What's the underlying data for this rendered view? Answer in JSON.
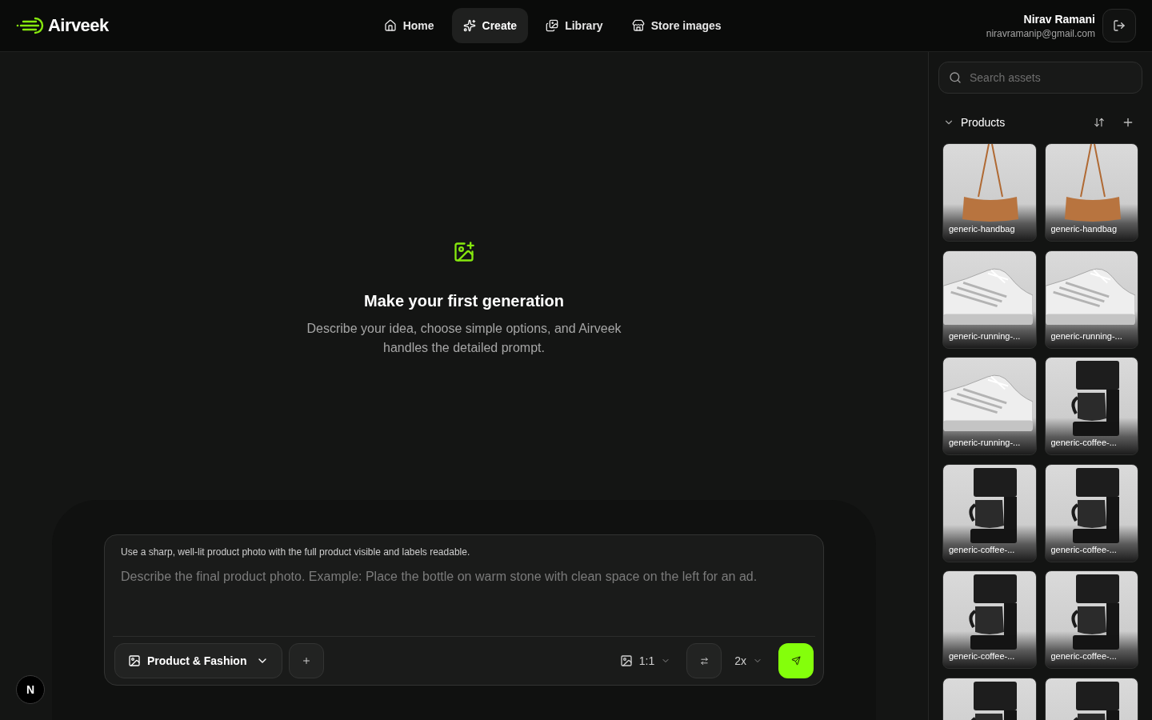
{
  "header": {
    "brand": "Airveek",
    "nav": [
      {
        "label": "Home",
        "selected": false
      },
      {
        "label": "Create",
        "selected": true
      },
      {
        "label": "Library",
        "selected": false
      },
      {
        "label": "Store images",
        "selected": false
      }
    ],
    "user": {
      "name": "Nirav Ramani",
      "email": "niravramanip@gmail.com"
    }
  },
  "empty_state": {
    "title": "Make your first generation",
    "description": "Describe your idea, choose simple options, and Airveek handles the detailed prompt."
  },
  "composer": {
    "hint": "Use a sharp, well-lit product photo with the full product visible and labels readable.",
    "placeholder": "Describe the final product photo. Example: Place the bottle on warm stone with clean space on the left for an ad.",
    "category": "Product & Fashion",
    "aspect_ratio": "1:1",
    "count": "2x"
  },
  "dev_badge": {
    "label": "N"
  },
  "sidebar": {
    "search": {
      "placeholder": "Search assets"
    },
    "section": {
      "title": "Products",
      "expanded": true,
      "items": [
        {
          "kind": "handbag",
          "label": "generic-handbag"
        },
        {
          "kind": "handbag",
          "label": "generic-handbag"
        },
        {
          "kind": "sneaker",
          "label": "generic-running-..."
        },
        {
          "kind": "sneaker",
          "label": "generic-running-..."
        },
        {
          "kind": "sneaker",
          "label": "generic-running-..."
        },
        {
          "kind": "coffee-maker",
          "label": "generic-coffee-..."
        },
        {
          "kind": "coffee-maker",
          "label": "generic-coffee-..."
        },
        {
          "kind": "coffee-maker",
          "label": "generic-coffee-..."
        },
        {
          "kind": "coffee-maker",
          "label": "generic-coffee-..."
        },
        {
          "kind": "coffee-maker",
          "label": "generic-coffee-..."
        },
        {
          "kind": "coffee-maker"
        },
        {
          "kind": "coffee-maker"
        }
      ]
    }
  }
}
